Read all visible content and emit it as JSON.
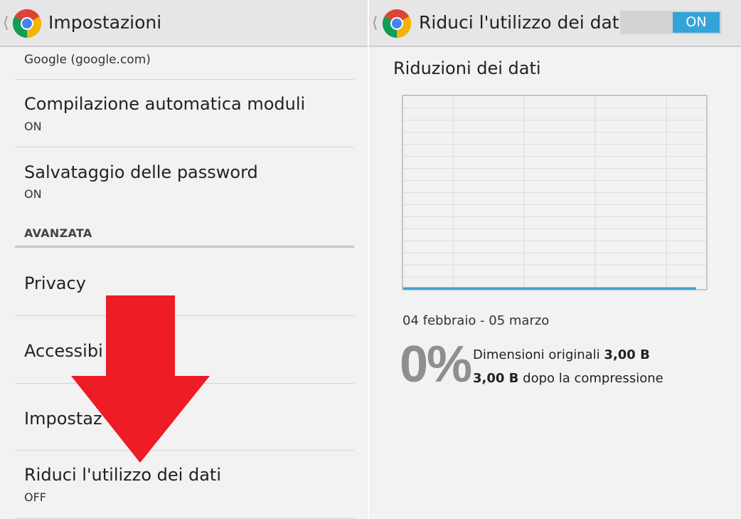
{
  "left": {
    "title": "Impostazioni",
    "partial_item": "Google (google.com)",
    "items": [
      {
        "title": "Compilazione automatica moduli",
        "sub": "ON"
      },
      {
        "title": "Salvataggio delle password",
        "sub": "ON"
      }
    ],
    "section_header": "AVANZATA",
    "advanced_items": [
      {
        "title": "Privacy"
      },
      {
        "title": "Accessibi"
      },
      {
        "title": "Impostaz"
      },
      {
        "title": "Riduci l'utilizzo dei dati",
        "sub": "OFF"
      }
    ]
  },
  "right": {
    "title": "Riduci l'utilizzo dei dati",
    "toggle_label": "ON",
    "heading": "Riduzioni dei dati",
    "period": "04 febbraio - 05 marzo",
    "percent": "0%",
    "original_label": "Dimensioni originali",
    "original_value": "3,00 B",
    "compressed_value": "3,00 B",
    "compressed_label": "dopo la compressione"
  },
  "chart_data": {
    "type": "line",
    "title": "",
    "xlabel": "",
    "ylabel": "",
    "series": [
      {
        "values": [
          0,
          0
        ]
      }
    ],
    "grid": true,
    "line_color": "#33a4d8"
  },
  "colors": {
    "accent": "#33a4d8",
    "arrow": "#ee1c24"
  }
}
